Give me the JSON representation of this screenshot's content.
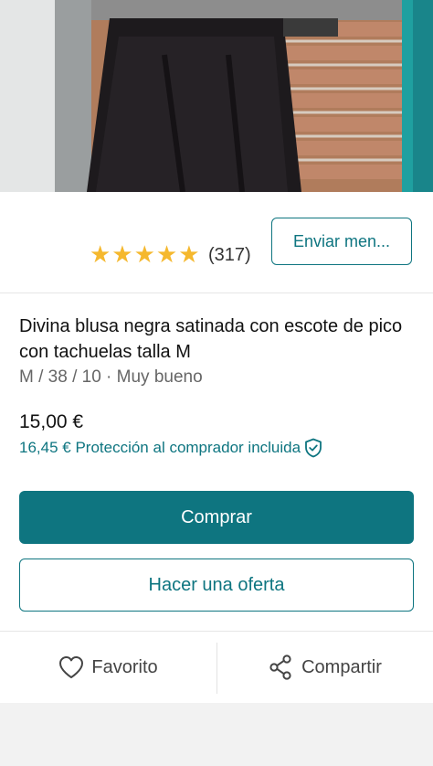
{
  "product": {
    "title": "Divina blusa negra satinada con escote de pico con tachuelas talla M",
    "meta": "M / 38 / 10 · Muy bueno",
    "price": "15,00 €",
    "protection_text": "16,45 € Protección al comprador incluida"
  },
  "seller": {
    "stars": "★★★★★",
    "rating_count": "(317)",
    "message_button_label": "Enviar men..."
  },
  "buttons": {
    "buy": "Comprar",
    "offer": "Hacer una oferta"
  },
  "actions": {
    "favorite": "Favorito",
    "share": "Compartir"
  },
  "icons": {
    "protection": "shield-check-icon",
    "favorite": "heart-icon",
    "share": "share-icon"
  },
  "colors": {
    "accent": "#0e7580",
    "star": "#f5b82e"
  }
}
